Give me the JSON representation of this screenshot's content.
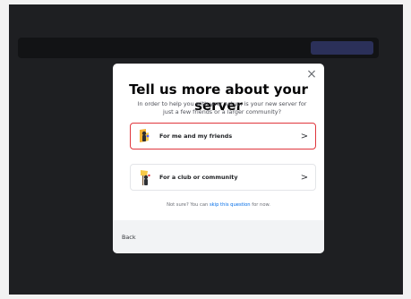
{
  "modal": {
    "title": "Tell us more about your server",
    "subtitle": "In order to help you with your setup, is your new server for just a few friends or a larger community?",
    "options": [
      {
        "label": "For me and my friends",
        "icon": "friends-icon",
        "selected": true
      },
      {
        "label": "For a club or community",
        "icon": "community-icon",
        "selected": false
      }
    ],
    "footnote_prefix": "Not sure? You can",
    "footnote_link": "skip this question",
    "footnote_suffix": "for now.",
    "back_label": "Back"
  },
  "colors": {
    "overlay": "#1e1f22",
    "selected_border": "#e0363c",
    "link": "#006ce7"
  }
}
